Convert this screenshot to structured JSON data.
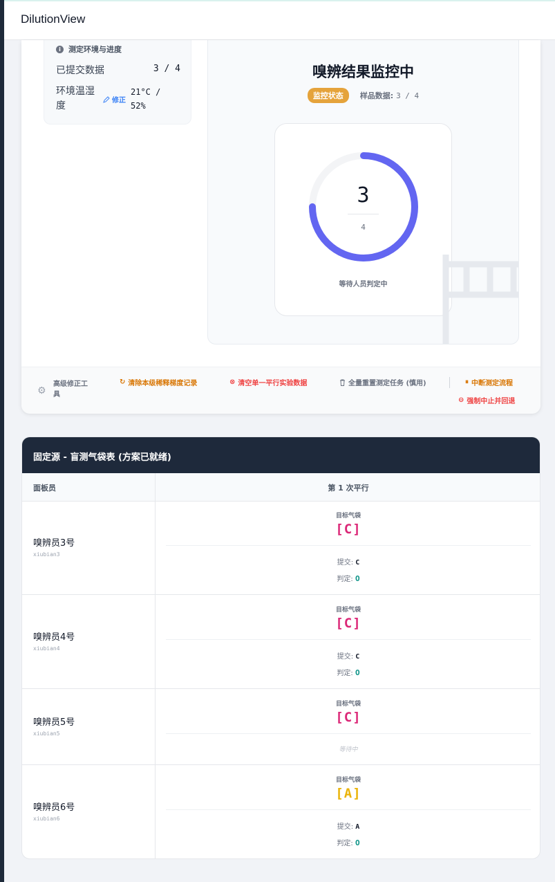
{
  "app": {
    "title": "DilutionView"
  },
  "env": {
    "heading": "测定环境与进度",
    "submitted_label": "已提交数据",
    "submitted_value": "3 / 4",
    "temp_label": "环境温湿度",
    "fix_label": "修正",
    "temp_value": "21°C / 52%"
  },
  "monitor": {
    "title": "嗅辨结果监控中",
    "badge": "监控状态",
    "sample_label": "样品数据:",
    "sample_value": "3 / 4",
    "progress_current": "3",
    "progress_total": "4",
    "progress_fraction": 0.75,
    "waiting_text": "等待人员判定中"
  },
  "toolbar": {
    "label": "高级修正工具",
    "clear_dilution": "清除本级稀释梯度记录",
    "clear_parallel": "清空单一平行实验数据",
    "reset_all": "全量重置测定任务 (慎用)",
    "interrupt": "中断测定流程",
    "force_stop": "强制中止并回退"
  },
  "colors": {
    "accent": "#6366f1",
    "badge": "#e5a33b",
    "bag_c": "#db2777",
    "bag_a": "#eab308",
    "judge_ok": "#0d9488"
  },
  "table": {
    "title": "固定源 - 盲测气袋表 (方案已就绪)",
    "col_panelist": "面板员",
    "col_round": "第 1 次平行",
    "target_label": "目标气袋",
    "submit_label": "提交:",
    "judge_label": "判定:",
    "waiting_label": "等待中",
    "rows": [
      {
        "name": "嗅辨员3号",
        "id": "xiubian3",
        "target": "[C]",
        "submit": "C",
        "judge": "O"
      },
      {
        "name": "嗅辨员4号",
        "id": "xiubian4",
        "target": "[C]",
        "submit": "C",
        "judge": "O"
      },
      {
        "name": "嗅辨员5号",
        "id": "xiubian5",
        "target": "[C]"
      },
      {
        "name": "嗅辨员6号",
        "id": "xiubian6",
        "target": "[A]",
        "submit": "A",
        "judge": "O"
      }
    ]
  }
}
